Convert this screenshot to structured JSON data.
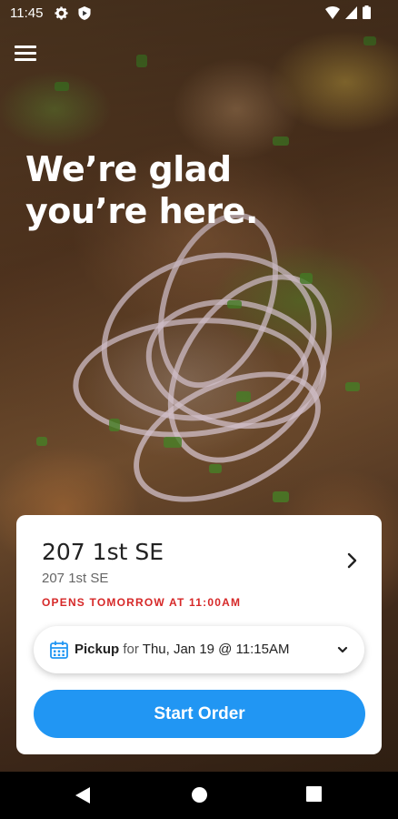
{
  "status_bar": {
    "time": "11:45",
    "left_icons": [
      "gear-icon",
      "shield-icon"
    ],
    "right_icons": [
      "wifi-icon",
      "signal-icon",
      "battery-icon"
    ]
  },
  "header": {
    "menu_icon": "hamburger-menu-icon",
    "headline": "We’re glad you’re here."
  },
  "location_card": {
    "name": "207 1st SE",
    "address": "207 1st SE",
    "status": "OPENS TOMORROW AT 11:00AM",
    "status_color": "#d62828",
    "pickup": {
      "mode": "Pickup",
      "connector": "for",
      "datetime": "Thu, Jan 19 @ 11:15AM"
    },
    "start_button_label": "Start Order",
    "accent_color": "#2196f3"
  },
  "nav_bar": {
    "buttons": [
      "back-icon",
      "home-icon",
      "recents-icon"
    ]
  }
}
